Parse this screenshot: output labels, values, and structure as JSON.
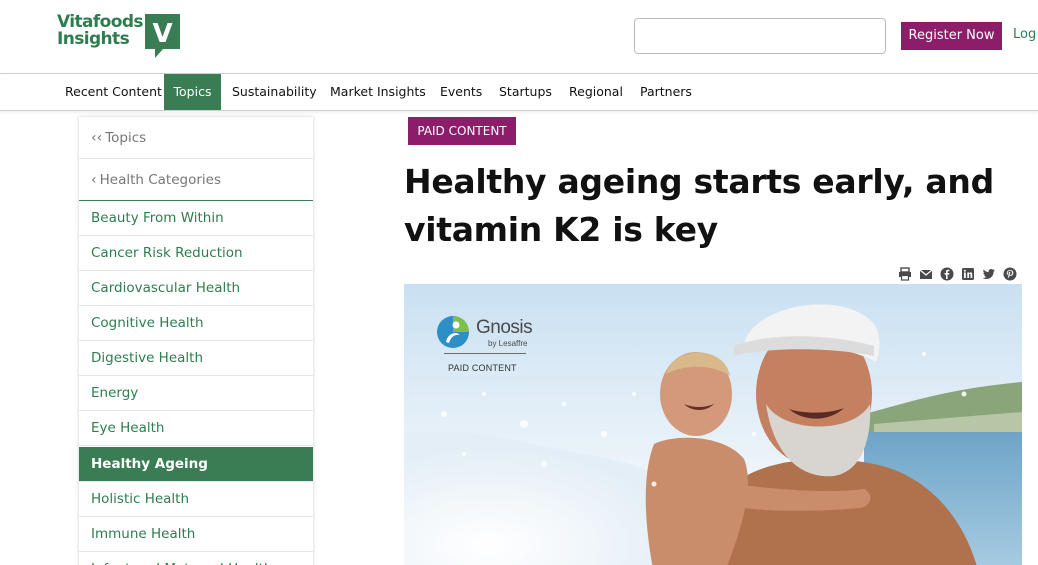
{
  "header": {
    "logo_line1": "Vitafoods",
    "logo_line2": "Insights",
    "logo_mark": "V",
    "search_placeholder": "",
    "register_label": "Register Now",
    "login_label": "Log In"
  },
  "nav": {
    "items": [
      {
        "label": "Recent Content"
      },
      {
        "label": "Topics",
        "active": true
      },
      {
        "label": "Sustainability"
      },
      {
        "label": "Market Insights"
      },
      {
        "label": "Events"
      },
      {
        "label": "Startups"
      },
      {
        "label": "Regional"
      },
      {
        "label": "Partners"
      }
    ]
  },
  "sidebar": {
    "back_topics": "Topics",
    "back_health": "Health Categories",
    "categories": [
      {
        "label": "Beauty From Within"
      },
      {
        "label": "Cancer Risk Reduction"
      },
      {
        "label": "Cardiovascular Health"
      },
      {
        "label": "Cognitive Health"
      },
      {
        "label": "Digestive Health"
      },
      {
        "label": "Energy"
      },
      {
        "label": "Eye Health"
      },
      {
        "label": "Healthy Ageing",
        "active": true
      },
      {
        "label": "Holistic Health"
      },
      {
        "label": "Immune Health"
      },
      {
        "label": "Infant and Maternal Health"
      }
    ]
  },
  "article": {
    "badge": "PAID CONTENT",
    "title_line1": "Healthy ageing starts early, and",
    "title_line2": "vitamin K2 is key",
    "share_icons": [
      "print-icon",
      "email-icon",
      "facebook-icon",
      "linkedin-icon",
      "twitter-icon",
      "pinterest-icon"
    ],
    "hero": {
      "brand": "Gnosis",
      "brand_sub": "by Lesaffre",
      "paid_label": "PAID CONTENT"
    }
  },
  "colors": {
    "brand_green": "#3a7d55",
    "link_green": "#2f7d4f",
    "accent_magenta": "#8c1d6b"
  }
}
